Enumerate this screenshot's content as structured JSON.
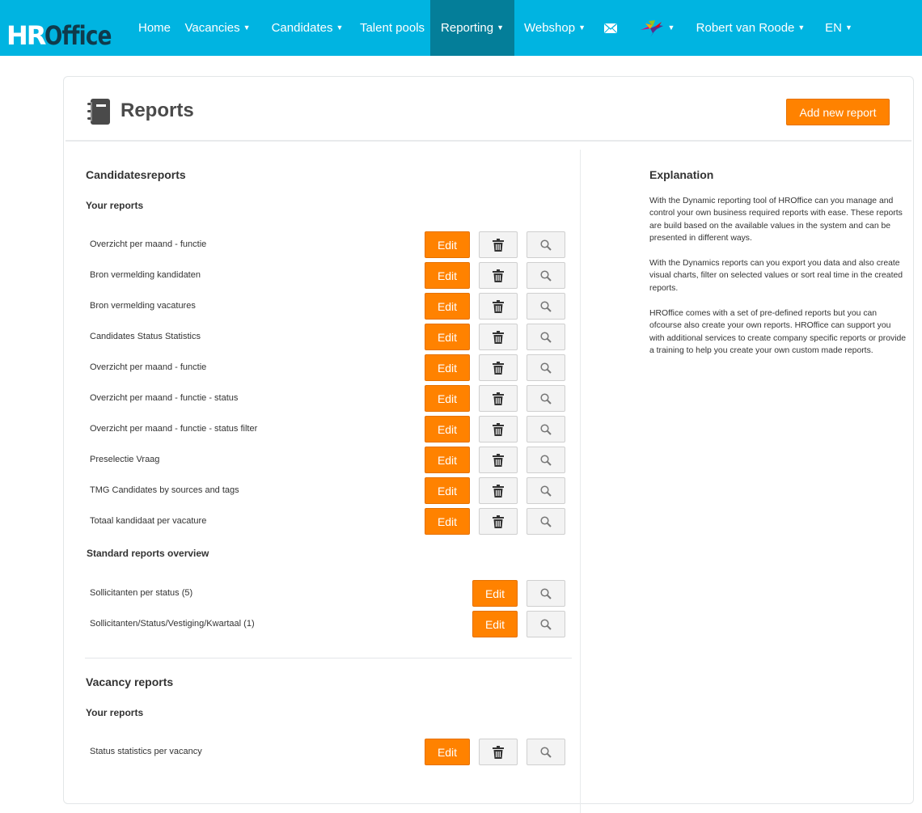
{
  "app": {
    "logo_hr": "HR",
    "logo_office": "Office"
  },
  "nav": {
    "home": "Home",
    "vacancies": "Vacancies",
    "candidates": "Candidates",
    "talent_pools": "Talent pools",
    "reporting": "Reporting",
    "webshop": "Webshop",
    "user": "Robert van Roode",
    "language": "EN",
    "caret": "⌄"
  },
  "page": {
    "title": "Reports",
    "add_button": "Add new report"
  },
  "candidates_section": {
    "title": "Candidatesreports",
    "your_reports_label": "Your reports",
    "rows": [
      "Overzicht per maand - functie",
      "Bron vermelding kandidaten",
      "Bron vermelding vacatures",
      "Candidates Status Statistics",
      "Overzicht per maand - functie",
      "Overzicht per maand - functie - status",
      "Overzicht per maand - functie - status filter",
      "Preselectie Vraag",
      "TMG Candidates by sources and tags",
      "Totaal kandidaat per vacature"
    ],
    "standard_label": "Standard reports overview",
    "standard_rows": [
      "Sollicitanten per status (5)",
      "Sollicitanten/Status/Vestiging/Kwartaal (1)"
    ]
  },
  "vacancy_section": {
    "title": "Vacancy reports",
    "your_reports_label": "Your reports",
    "rows": [
      "Status statistics per vacancy"
    ]
  },
  "buttons": {
    "edit": "Edit"
  },
  "explanation": {
    "title": "Explanation",
    "p1": "With the Dynamic reporting tool of HROffice can you manage and control your own business required reports with ease. These reports are build based on the available values in the system and can be presented in different ways.",
    "p2": "With the Dynamics reports can you export you data and also create visual charts, filter on selected values or sort real time in the created reports.",
    "p3": "HROffice comes with a set of pre-defined reports but you can ofcourse also create your own reports. HROffice can support you with additional services to create company specific reports or provide a training to help you create your own custom made reports."
  },
  "colors": {
    "nav_bg": "#00b4e1",
    "nav_active": "#047e99",
    "accent_orange": "#ff8200"
  },
  "icons": [
    "notebook-icon",
    "mail-icon",
    "hummingbird-icon",
    "trash-icon",
    "search-icon",
    "chevron-down-icon"
  ]
}
